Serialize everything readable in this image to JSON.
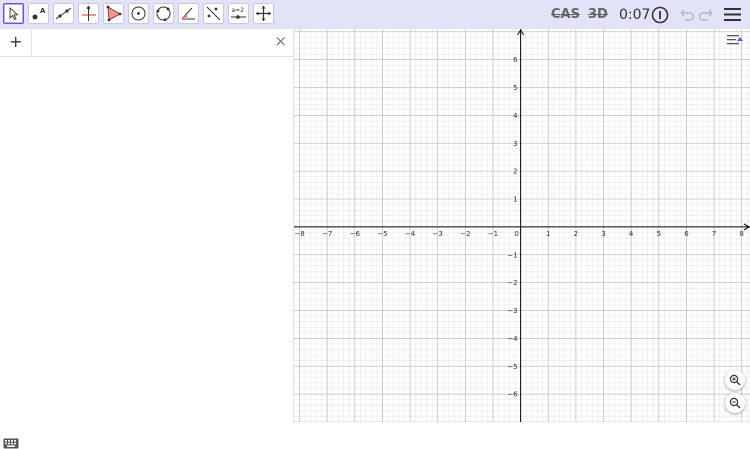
{
  "toolbar": {
    "tools": [
      {
        "id": "move",
        "icon": "move-arrow-icon",
        "active": true
      },
      {
        "id": "point",
        "icon": "point-icon",
        "badge": "A"
      },
      {
        "id": "line",
        "icon": "line-icon"
      },
      {
        "id": "perpendicular",
        "icon": "perpendicular-icon"
      },
      {
        "id": "polygon",
        "icon": "polygon-icon"
      },
      {
        "id": "circle-center",
        "icon": "circle-center-icon"
      },
      {
        "id": "circle-three-points",
        "icon": "circle-three-points-icon"
      },
      {
        "id": "angle",
        "icon": "angle-icon"
      },
      {
        "id": "reflect",
        "icon": "reflect-icon"
      },
      {
        "id": "slider",
        "icon": "slider-icon",
        "badge": "a=2"
      },
      {
        "id": "move-graphics",
        "icon": "move-graphics-icon"
      }
    ],
    "cas_label": "CAS",
    "threed_label": "3D",
    "timer": "0:07"
  },
  "algebra": {
    "add_symbol": "+",
    "close_symbol": "×"
  },
  "graphics": {
    "x_ticks": [
      "−8",
      "−7",
      "−6",
      "−5",
      "−4",
      "−3",
      "−2",
      "−1",
      "0",
      "1",
      "2",
      "3",
      "4",
      "5",
      "6",
      "7",
      "8"
    ],
    "y_ticks": [
      "6",
      "5",
      "4",
      "3",
      "2",
      "1",
      "−1",
      "−2",
      "−3",
      "−4",
      "−5",
      "−6"
    ],
    "x_range": [
      -8.2,
      8.3
    ],
    "y_range": [
      -7.0,
      7.1
    ],
    "grid": true
  },
  "colors": {
    "toolbar_bg": "#e2e2f9",
    "accent": "#6557d2",
    "axis": "#000000",
    "major_grid": "#c0c0c0",
    "minor_grid": "#e6e6e6"
  }
}
